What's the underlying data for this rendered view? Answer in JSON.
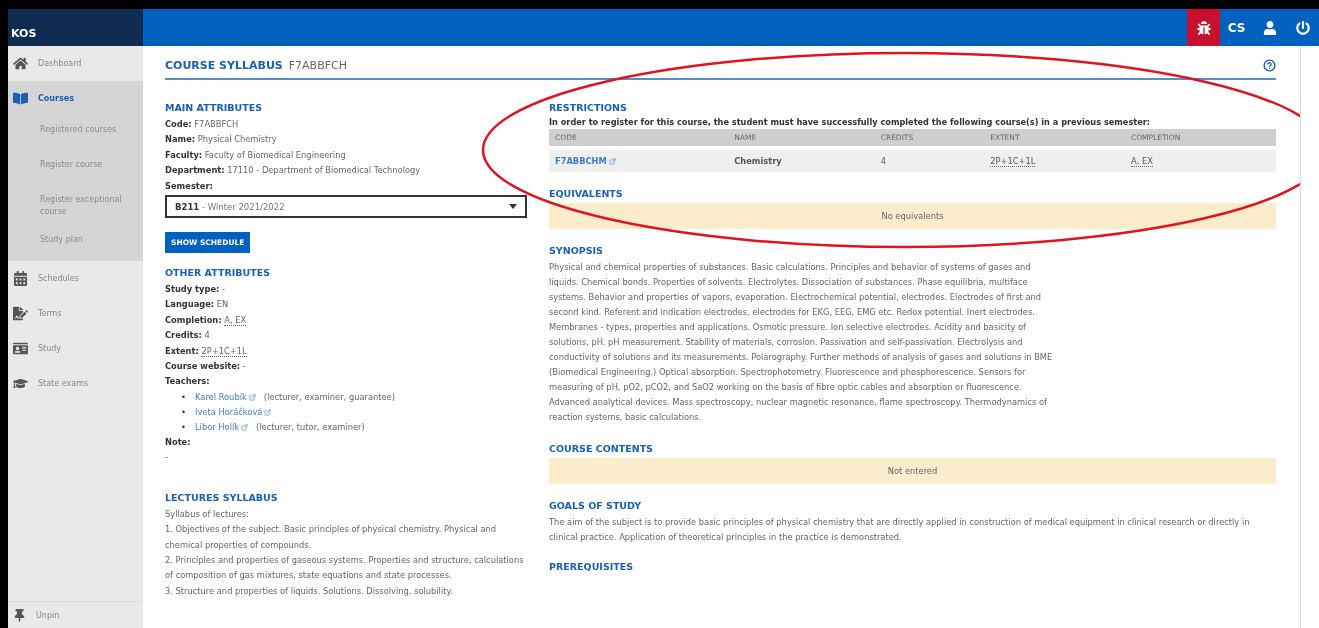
{
  "app": {
    "logo": "KOS"
  },
  "top_bar": {
    "language": "CS"
  },
  "sidebar": {
    "items": [
      {
        "label": "Dashboard",
        "selected": false
      },
      {
        "label": "Courses",
        "selected": true,
        "expanded": true,
        "children": [
          {
            "label": "Registered courses",
            "selected": false
          },
          {
            "label": "Register course",
            "selected": false
          },
          {
            "label": "Register exceptional course",
            "selected": false
          },
          {
            "label": "Study plan",
            "selected": false
          }
        ]
      },
      {
        "label": "Schedules",
        "selected": false
      },
      {
        "label": "Terms",
        "selected": false
      },
      {
        "label": "Study",
        "selected": false
      },
      {
        "label": "State exams",
        "selected": false
      }
    ],
    "unpin": "Unpin"
  },
  "page": {
    "title": "COURSE SYLLABUS",
    "code": "F7ABBFCH"
  },
  "main_attributes": {
    "heading": "MAIN ATTRIBUTES",
    "fields": [
      {
        "label": "Code:",
        "value": "F7ABBFCH",
        "kind": "text"
      },
      {
        "label": "Name:",
        "value": "Physical Chemistry",
        "kind": "text"
      },
      {
        "label": "Faculty:",
        "value": "Faculty of Biomedical Engineering",
        "kind": "text"
      },
      {
        "label": "Department:",
        "value": "17110 - Department of Biomedical Technology",
        "kind": "text"
      }
    ],
    "semester": {
      "label": "Semester:",
      "code": "B211",
      "value": "- Winter 2021/2022"
    },
    "button": "SHOW SCHEDULE"
  },
  "other_attributes": {
    "heading": "OTHER ATTRIBUTES",
    "fields": [
      {
        "label": "Study type:",
        "value": "-",
        "kind": "text"
      },
      {
        "label": "Language:",
        "value": "EN",
        "kind": "text"
      },
      {
        "label": "Completion:",
        "value": "A, EX",
        "kind": "abbr"
      },
      {
        "label": "Credits:",
        "value": "4",
        "kind": "text"
      },
      {
        "label": "Extent:",
        "value": "2P+1C+1L",
        "kind": "abbr"
      },
      {
        "label": "Course website:",
        "value": "-",
        "kind": "text"
      }
    ],
    "teachers_label": "Teachers:",
    "teachers": [
      {
        "bullet": "•",
        "name": "Karel Roubík",
        "roles": "(lecturer, examiner, guarantee)"
      },
      {
        "bullet": "•",
        "name": "Iveta Horáčková"
      },
      {
        "bullet": "•",
        "name": "Libor Holík",
        "roles": "(lecturer, tutor, examiner)"
      }
    ],
    "note_label": "Note:",
    "note": "-"
  },
  "lectures": {
    "heading": "LECTURES SYLLABUS",
    "paragraphs": [
      "Syllabus of lectures:",
      "1. Objectives of the subject. Basic principles of physical chemistry. Physical and chemical properties of compounds.",
      "2. Principles and properties of gaseous systems. Properties and structure, calculations of composition of gas mixtures, state equations and state processes.",
      "3. Structure and properties of liquids. Solutions. Dissolving, solubility."
    ]
  },
  "restrictions": {
    "heading": "RESTRICTIONS",
    "text": "In order to register for this course, the student must have successfully completed the following course(s) in a previous semester:",
    "columns": [
      "CODE",
      "NAME",
      "CREDITS",
      "EXTENT",
      "COMPLETION"
    ],
    "rows": [
      {
        "code": "F7ABBCHM",
        "name": "Chemistry",
        "credits": "4",
        "extent": "2P+1C+1L",
        "completion": "A, EX"
      }
    ]
  },
  "equivalents": {
    "heading": "EQUIVALENTS",
    "notice": "No equivalents"
  },
  "synopsis": {
    "heading": "SYNOPSIS",
    "text": "Physical and chemical properties of substances. Basic calculations. Principles and behavior of systems of gases and liquids. Chemical bonds. Properties of solvents. Electrolytes. Dissociation of substances. Phase equilibria, multiface systems. Behavior and properties of vapors, evaporation. Electrochemical potential, electrodes. Electrodes of first and second kind. Referent and indication electrodes, electrodes for EKG, EEG, EMG etc. Redox potential. Inert electrodes. Membranes - types, properties and applications. Osmotic pressure. Ion selective electrodes. Acidity and basicity of solutions, pH. pH measurement. Stability of materials, corrosion. Passivation and self-passivation. Electrolysis and conductivity of solutions and its measurements. Polarography. Further methods of analysis of gases and solutions in BME (Biomedical Engineering.) Optical absorption. Spectrophotometry. Fluorescence and phosphorescence. Sensors for measuring of pH, pO2, pCO2, and SaO2 working on the basis of fibre optic cables and absorption or fluorescence. Advanced analytical devices. Mass spectroscopy, nuclear magnetic resonance, flame spectroscopy. Thermodynamics of reaction systems, basic calculations."
  },
  "course_contents": {
    "heading": "COURSE CONTENTS",
    "notice": "Not entered"
  },
  "goals": {
    "heading": "GOALS OF STUDY",
    "text": "The aim of the subject is to provide basic principles of physical chemistry that are directly applied in construction of medical equipment in clinical research or directly in clinical practice. Application of theoretical principles in the practice is demonstrated."
  },
  "prerequisites": {
    "heading": "PREREQUISITES"
  }
}
